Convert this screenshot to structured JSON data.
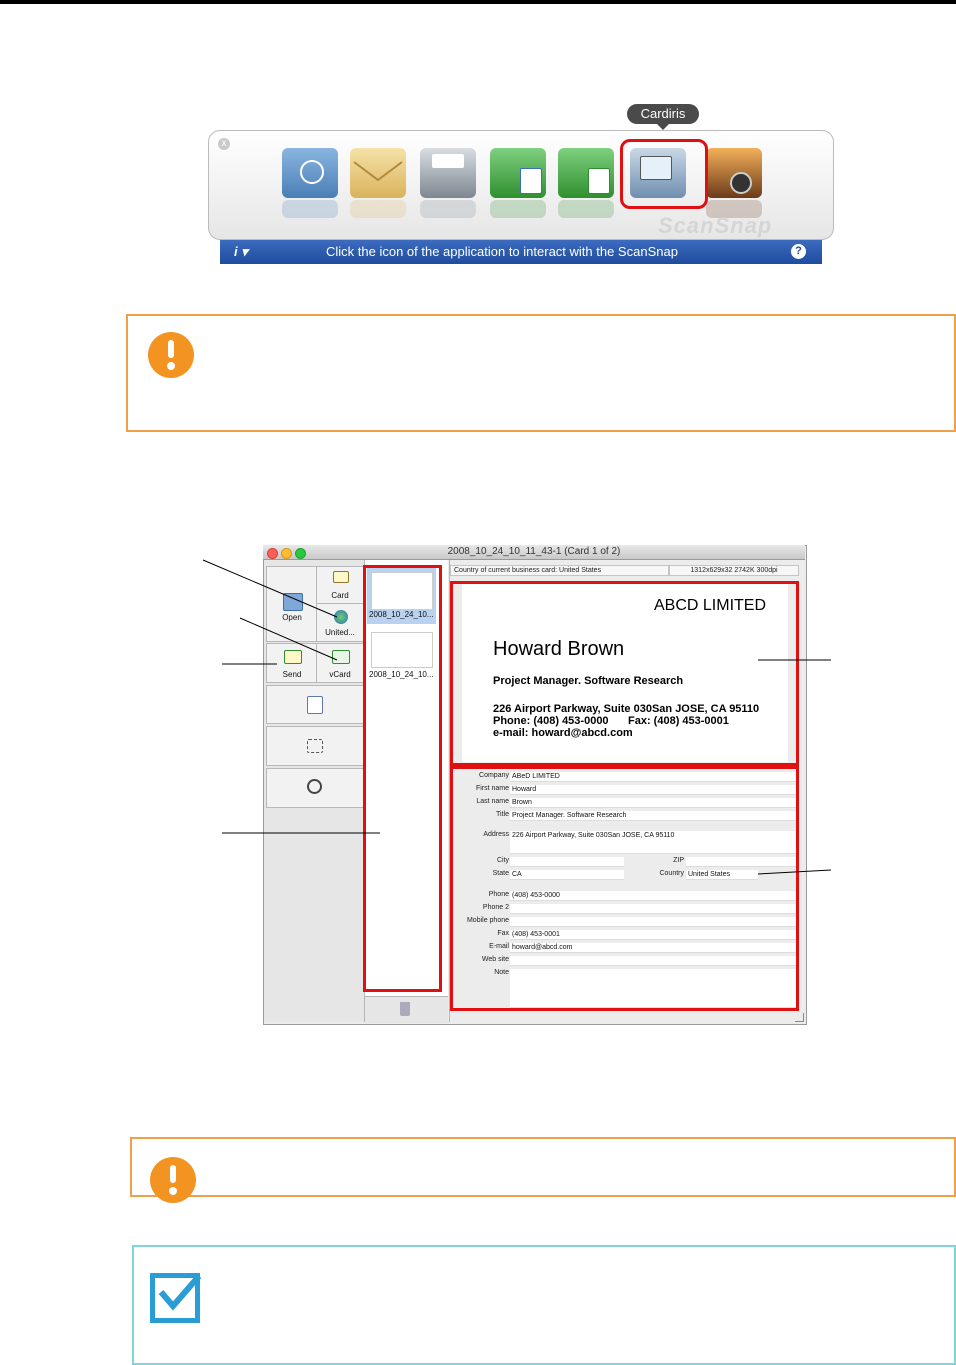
{
  "quick_menu": {
    "tooltip": "Cardiris",
    "close_glyph": "x",
    "apps": [
      {
        "name": "scansnap-folder",
        "color": "#5b8fc4"
      },
      {
        "name": "email",
        "color": "#e9c77a"
      },
      {
        "name": "printer",
        "color": "#9aa3ab"
      },
      {
        "name": "abbyy-finereader-word",
        "color": "#3a9b3a"
      },
      {
        "name": "abbyy-finereader-excel",
        "color": "#3a9b3a"
      },
      {
        "name": "cardiris",
        "color": "#6f8fb0"
      },
      {
        "name": "iphoto",
        "color": "#b5652c"
      }
    ],
    "brand": "ScanSnap",
    "info_label": "i ▾",
    "message": "Click the icon of the application to interact with the ScanSnap",
    "help_glyph": "?"
  },
  "cardiris": {
    "title": "2008_10_24_10_11_43-1 (Card 1 of 2)",
    "toolbar": {
      "open": "Open",
      "card": "Card",
      "country": "United...",
      "send": "Send",
      "vcard": "vCard"
    },
    "thumbnails": [
      {
        "label": "2008_10_24_10..."
      },
      {
        "label": "2008_10_24_10..."
      }
    ],
    "status_country": "Country of current business card: United States",
    "status_image": "1312x629x32  2742K  300dpi",
    "card": {
      "company": "ABCD LIMITED",
      "name": "Howard Brown",
      "position": "Project Manager. Software Research",
      "address": "226 Airport Parkway, Suite 030San JOSE, CA 95110",
      "phone_line": "Phone: (408) 453-0000",
      "fax_line": "Fax: (408) 453-0001",
      "email_line": "e-mail: howard@abcd.com"
    },
    "fields": {
      "company": {
        "label": "Company",
        "value": "ABeD LIMITED"
      },
      "first_name": {
        "label": "First name",
        "value": "Howard"
      },
      "last_name": {
        "label": "Last name",
        "value": "Brown"
      },
      "title": {
        "label": "Title",
        "value": "Project Manager. Software Research"
      },
      "address": {
        "label": "Address",
        "value": "226 Airport Parkway, Suite 030San JOSE, CA 95110"
      },
      "city": {
        "label": "City",
        "value": ""
      },
      "zip": {
        "label": "ZIP",
        "value": ""
      },
      "state": {
        "label": "State",
        "value": "CA"
      },
      "country": {
        "label": "Country",
        "value": "United States"
      },
      "phone": {
        "label": "Phone",
        "value": "(408) 453-0000"
      },
      "phone2": {
        "label": "Phone 2",
        "value": ""
      },
      "mobile": {
        "label": "Mobile phone",
        "value": ""
      },
      "fax": {
        "label": "Fax",
        "value": "(408) 453-0001"
      },
      "email": {
        "label": "E-mail",
        "value": "howard@abcd.com"
      },
      "website": {
        "label": "Web site",
        "value": ""
      },
      "note": {
        "label": "Note",
        "value": ""
      }
    }
  },
  "colors": {
    "highlight_red": "#e01010",
    "note_orange": "#f0a04b",
    "hint_cyan": "#7fd6d6",
    "bar_blue": "#1e4c9e"
  }
}
